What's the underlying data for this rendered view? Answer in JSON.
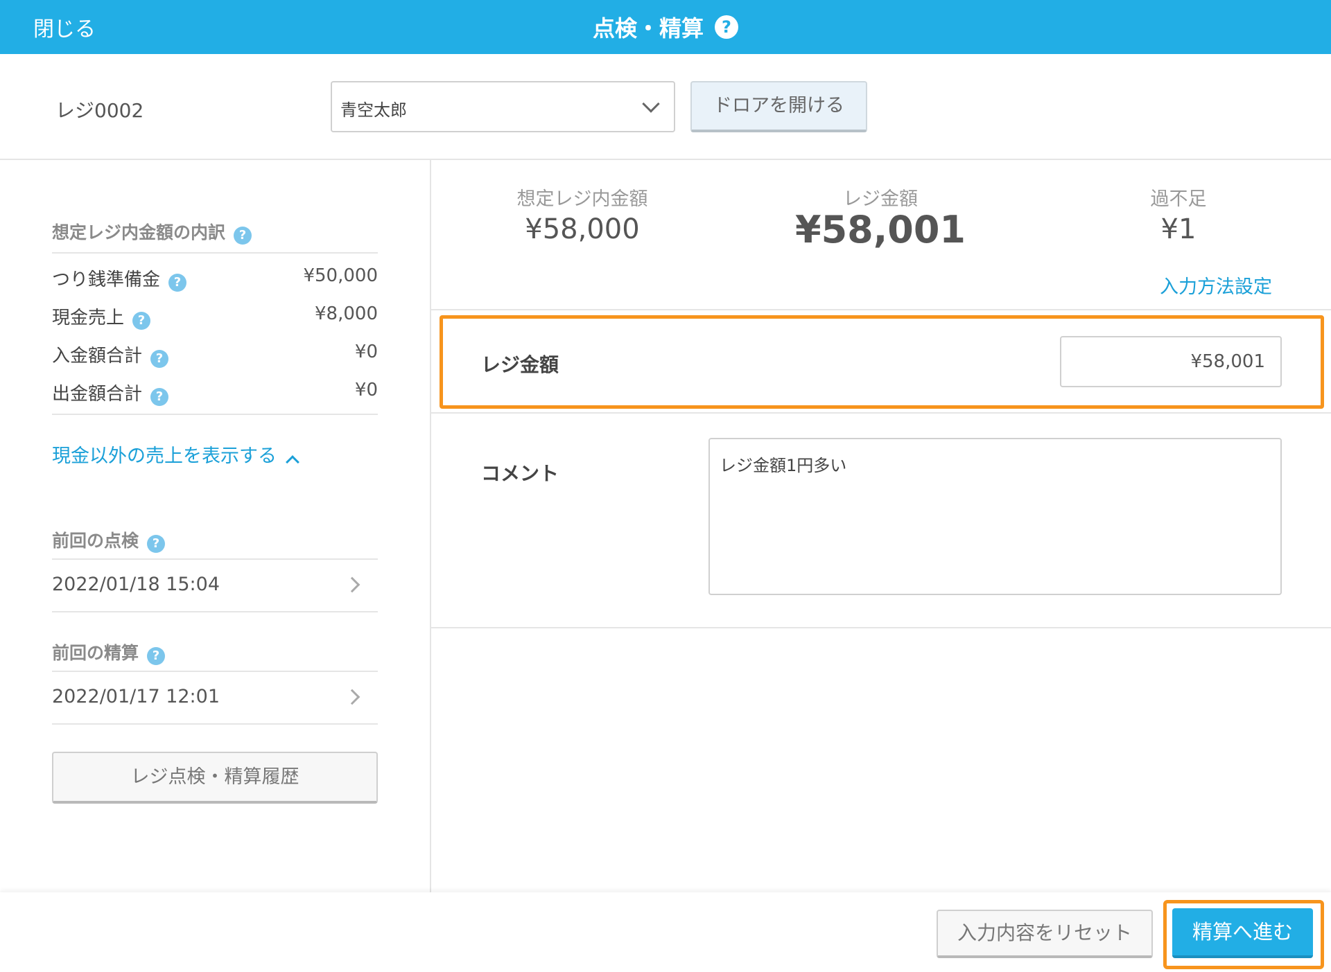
{
  "header": {
    "close_label": "閉じる",
    "title": "点検・精算",
    "help_glyph": "?"
  },
  "register": {
    "name": "レジ0002",
    "staff_selected": "青空太郎",
    "drawer_button": "ドロアを開ける"
  },
  "breakdown": {
    "title": "想定レジ内金額の内訳",
    "rows": [
      {
        "label": "つり銭準備金",
        "value": "¥50,000"
      },
      {
        "label": "現金売上",
        "value": "¥8,000"
      },
      {
        "label": "入金額合計",
        "value": "¥0"
      },
      {
        "label": "出金額合計",
        "value": "¥0"
      }
    ],
    "toggle_link": "現金以外の売上を表示する"
  },
  "previous_check": {
    "title": "前回の点検",
    "datetime": "2022/01/18 15:04"
  },
  "previous_settlement": {
    "title": "前回の精算",
    "datetime": "2022/01/17 12:01"
  },
  "history_button": "レジ点検・精算履歴",
  "summary": {
    "expected_label": "想定レジ内金額",
    "expected_value": "¥58,000",
    "register_label": "レジ金額",
    "register_value": "¥58,001",
    "diff_label": "過不足",
    "diff_value": "¥1",
    "input_settings_link": "入力方法設定"
  },
  "form": {
    "amount_label": "レジ金額",
    "amount_value": "¥58,001",
    "comment_label": "コメント",
    "comment_value": "レジ金額1円多い"
  },
  "footer": {
    "reset_button": "入力内容をリセット",
    "proceed_button": "精算へ進む"
  },
  "colors": {
    "header_bg": "#22aee5",
    "link": "#1ba0d8",
    "highlight": "#f7941d",
    "help_icon": "#7cc6ec"
  }
}
